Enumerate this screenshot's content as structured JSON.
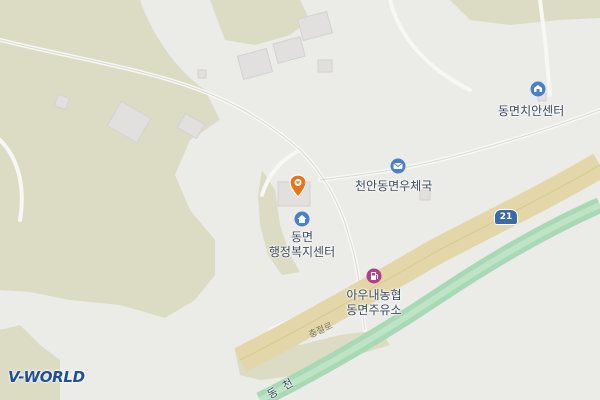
{
  "map": {
    "provider_logo": "V-WORLD",
    "labels": {
      "police_center": "동면치안센터",
      "post_office": "천안동면우체국",
      "admin_center_line1": "동면",
      "admin_center_line2": "행정복지센터",
      "gas_station_line1": "아우내농협",
      "gas_station_line2": "동면주유소",
      "road_name": "충절로",
      "route_number": "21",
      "river_name": "동 천"
    },
    "icons": {
      "police_center": "police-icon",
      "post_office": "post-office-icon",
      "admin_center": "home-icon",
      "gas_station": "gas-station-icon",
      "selected_marker": "location-pin-icon"
    },
    "colors": {
      "background": "#ebebe8",
      "hills": "#dcdcc4",
      "main_road": "#e3d6a8",
      "river": "#a8d8b4",
      "poi_icon": "#4a80c8",
      "gas_icon": "#b0408c",
      "marker": "#e8751a"
    }
  }
}
